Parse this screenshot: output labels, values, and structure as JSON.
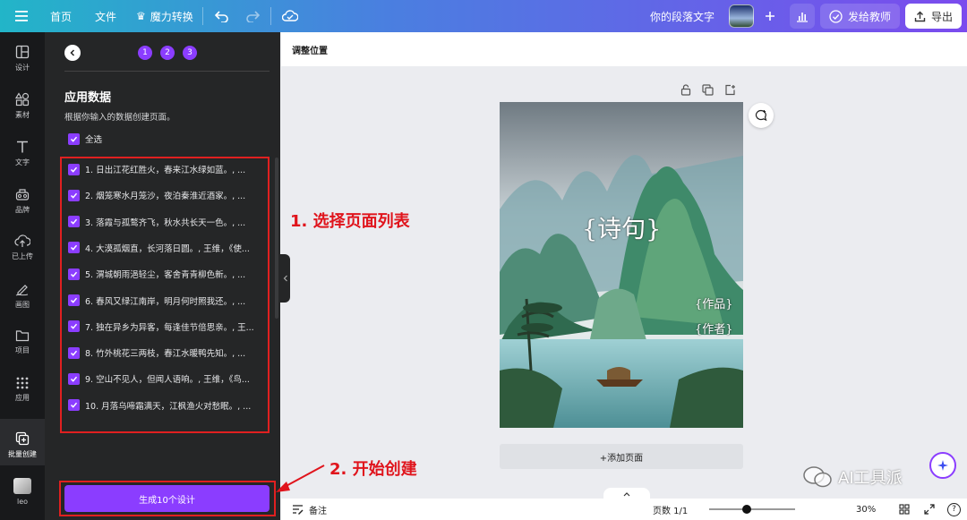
{
  "topbar": {
    "home": "首页",
    "file": "文件",
    "magic": "魔力转换",
    "doc_title": "你的段落文字",
    "teach": "发给教师",
    "export": "导出"
  },
  "rail": {
    "items": [
      {
        "label": "设计",
        "icon": "layout-icon"
      },
      {
        "label": "素材",
        "icon": "shapes-icon"
      },
      {
        "label": "文字",
        "icon": "text-icon"
      },
      {
        "label": "品牌",
        "icon": "brand-icon"
      },
      {
        "label": "已上传",
        "icon": "upload-icon"
      },
      {
        "label": "画图",
        "icon": "draw-icon"
      },
      {
        "label": "项目",
        "icon": "folder-icon"
      },
      {
        "label": "应用",
        "icon": "apps-icon"
      },
      {
        "label": "批量创建",
        "icon": "bulk-create-icon"
      },
      {
        "label": "leo",
        "icon": "avatar-icon"
      }
    ]
  },
  "panel": {
    "steps": [
      "1",
      "2",
      "3"
    ],
    "title": "应用数据",
    "desc": "根据你输入的数据创建页面。",
    "select_all": "全选",
    "rows": [
      "1. 日出江花红胜火，春来江水绿如蓝。, ...",
      "2. 烟笼寒水月笼沙，夜泊秦淮近酒家。, ...",
      "3. 落霞与孤鹜齐飞，秋水共长天一色。, ...",
      "4. 大漠孤烟直，长河落日圆。, 王维，《使...",
      "5. 渭城朝雨浥轻尘，客舍青青柳色新。, ...",
      "6. 春风又绿江南岸，明月何时照我还。, ...",
      "7. 独在异乡为异客，每逢佳节倍思亲。, 王...",
      "8. 竹外桃花三两枝，春江水暖鸭先知。, ...",
      "9. 空山不见人，但闻人语响。, 王维，《鸟...",
      "10. 月落乌啼霜满天，江枫渔火对愁眠。, ..."
    ],
    "generate": "生成10个设计"
  },
  "annotations": {
    "a1": "1. 选择页面列表",
    "a2": "2. 开始创建"
  },
  "canvas": {
    "subbar": "调整位置",
    "poem_placeholder": "{诗句}",
    "work_placeholder": "{作品}",
    "author_placeholder": "{作者}",
    "add_page": "+添加页面"
  },
  "bottombar": {
    "notes": "备注",
    "pages": "页数 1/1",
    "zoom": "30%",
    "zoom_value": 0.3,
    "help": "?"
  },
  "watermark": "AI工具派",
  "colors": {
    "accent": "#8b3dff",
    "annotation": "#e0141c"
  }
}
